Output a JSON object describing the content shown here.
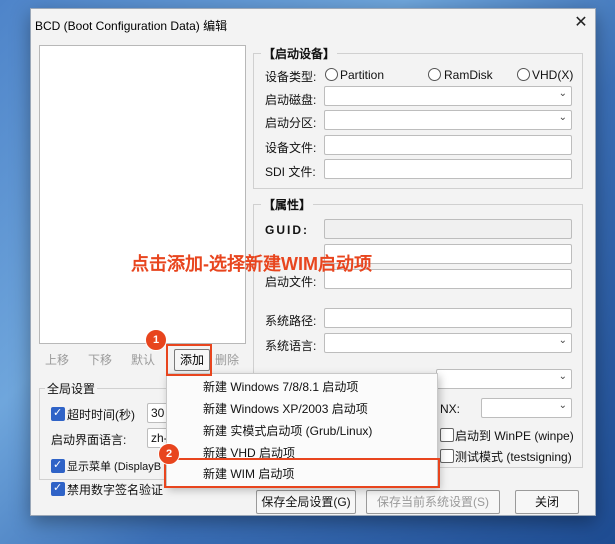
{
  "window": {
    "title": "BCD (Boot Configuration Data) 编辑",
    "close_icon": "close-icon"
  },
  "list_buttons": {
    "up": "上移",
    "down": "下移",
    "default": "默认",
    "add": "添加",
    "delete": "删除"
  },
  "boot_device": {
    "title": "【启动设备】",
    "device_type_label": "设备类型:",
    "options": [
      "Partition",
      "RamDisk",
      "VHD(X)"
    ],
    "boot_disk_label": "启动磁盘:",
    "boot_partition_label": "启动分区:",
    "device_file_label": "设备文件:",
    "sdi_file_label": "SDI 文件:"
  },
  "properties": {
    "title": "【属性】",
    "guid_label": "GUID:",
    "boot_file_label_partial": "启动文件:",
    "system_path_label": "系统路径:",
    "system_language_label": "系统语言:",
    "nx_label": "NX:",
    "boot_to_winpe": "启动到 WinPE (winpe)",
    "test_mode": "测试模式 (testsigning)"
  },
  "global": {
    "title": "全局设置",
    "timeout_label": "超时时间(秒)",
    "timeout_value": "30",
    "ui_language_label": "启动界面语言:",
    "ui_language_value": "zh-",
    "show_menu": "显示菜单 (DisplayB",
    "disable_signature": "禁用数字签名验证"
  },
  "context_menu": {
    "items": [
      "新建 Windows 7/8/8.1 启动项",
      "新建 Windows XP/2003 启动项",
      "新建 实模式启动项 (Grub/Linux)",
      "新建 VHD 启动项",
      "新建 WIM 启动项"
    ]
  },
  "footer": {
    "save_global": "保存全局设置(G)",
    "save_current": "保存当前系统设置(S)",
    "close": "关闭"
  },
  "annotation": {
    "text": "点击添加-选择新建WIM启动项",
    "step1": "1",
    "step2": "2",
    "color": "#e8451e"
  }
}
